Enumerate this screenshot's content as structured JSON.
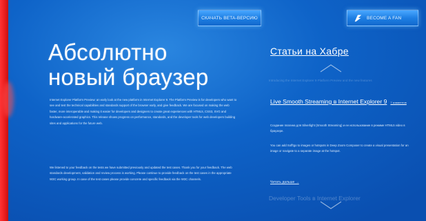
{
  "header": {
    "download_button": "Скачать Beta-версию",
    "facebook_button": "Become a fan"
  },
  "hero": {
    "title_line1": "Абсолютно",
    "title_line2": "новый браузер",
    "paragraph1": "Internet Explorer Platform Preview: an early look at the new platform in Internet Explorer 9. The Platform Preview is for developers who want to see and test the technical capabilities and standards support of the browser early, and give feedback. We are focused on making the web faster, more interoperable and making it easier for developers and designers to create great experiences with HTML5, CSS3, SVG and hardware-accelerated graphics. This release shows progress on performance, standards, and the developer tools for web developers building sites and applications for the future web.",
    "paragraph2": "We listened to your feedback on the tests we have submitted previously and updated the test cases. Thank you for your feedback. The web standards development, validation and review process is working. Please continue to provide feedback on the test cases in the appropriate W3C working group. In case of the test cases please provide concrete and specific feedback via the W3C channels."
  },
  "sidebar": {
    "title": "Статьи на Хабре",
    "faded_above": "Introducing the Internet Explorer 9 Platform Preview and the new features",
    "article": {
      "title": "Live Smooth Streaming в Internet Explorer 9",
      "badge": "7 комментов",
      "text1": "Создание плагина для Silverlight (Smooth Streaming) и ее использование в режиме HTML5 video в браузере.",
      "text2": "You can add Sofftgo to images or hotspots in Deep Zoom Composer to create a visual presentation for an image or navigate to a separate image at the hotspot."
    },
    "more_link": "Читать дальше →",
    "faded_below": "Developer Tools в Internet Explorer"
  },
  "icons": {
    "facebook": "facebook-f-icon",
    "chevron_up": "chevron-up-icon",
    "chevron_down": "chevron-down-icon"
  },
  "colors": {
    "background": "#0e63c8",
    "accent_red": "#e81c1c",
    "button": "#1e7fe4"
  }
}
